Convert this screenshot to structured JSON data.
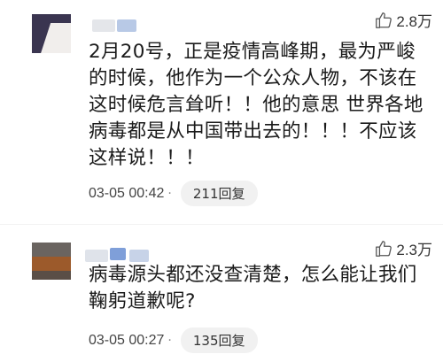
{
  "comments": [
    {
      "likes": "2.8万",
      "text": "2月20号，正是疫情高峰期，最为严峻的时候，他作为一个公众人物，不该在这时候危言耸听！！他的意思 世界各地病毒都是从中国带出去的！！！不应该这样说！！！",
      "time": "03-05 00:42",
      "separator": "·",
      "reply": "211回复",
      "icons": {
        "avatar": "avatar-image",
        "like": "thumbs-up-icon"
      }
    },
    {
      "likes": "2.3万",
      "text": "病毒源头都还没查清楚，怎么能让我们鞠躬道歉呢?",
      "time": "03-05 00:27",
      "separator": "·",
      "reply": "135回复",
      "icons": {
        "avatar": "avatar-image",
        "like": "thumbs-up-icon"
      }
    }
  ],
  "colors": {
    "text": "#1a1a1a",
    "meta": "#444444",
    "reply_bg": "#f1f1f1"
  }
}
